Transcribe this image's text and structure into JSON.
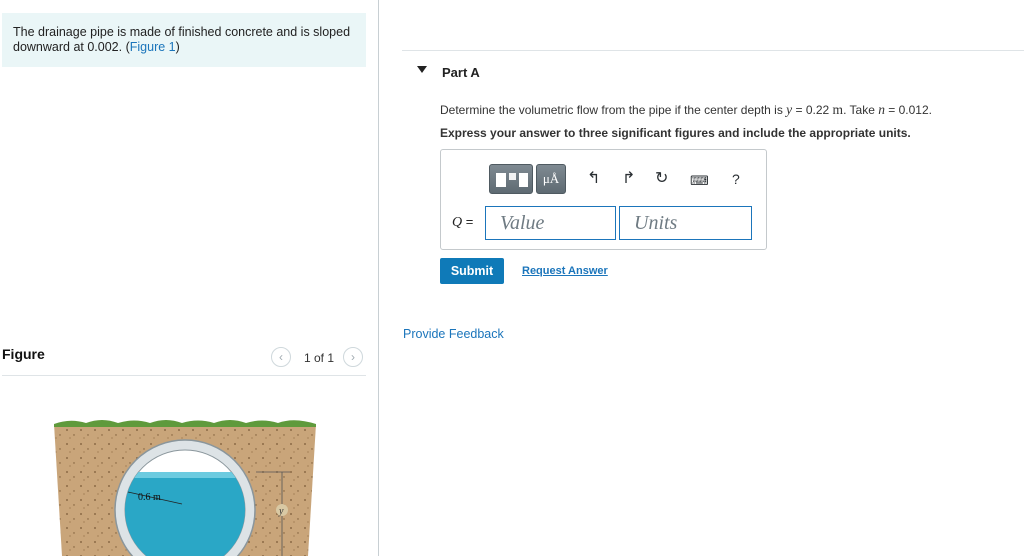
{
  "problem": {
    "text": "The drainage pipe is made of finished concrete and is sloped downward at 0.002. (",
    "figure_link": "Figure 1",
    "close_paren": ")"
  },
  "figure": {
    "heading": "Figure",
    "pager_text": "1 of 1",
    "prev_icon": "chevron-left-icon",
    "next_icon": "chevron-right-icon",
    "diameter_label": "0.6 m",
    "depth_label": "y"
  },
  "part": {
    "title": "Part A",
    "question_pre": "Determine the volumetric flow from the pipe if the center depth is ",
    "question_var": "y",
    "question_eq": " = 0.22 ",
    "question_unit": "m",
    "question_mid": ". Take ",
    "question_var2": "n",
    "question_post": " = 0.012.",
    "instruction": "Express your answer to three significant figures and include the appropriate units."
  },
  "answer": {
    "variable": "Q",
    "equals": " =",
    "units_button_label": "μÅ",
    "help_label": "?",
    "value_placeholder": "Value",
    "units_placeholder": "Units"
  },
  "actions": {
    "submit_label": "Submit",
    "request_label": "Request Answer",
    "feedback_label": "Provide Feedback"
  }
}
